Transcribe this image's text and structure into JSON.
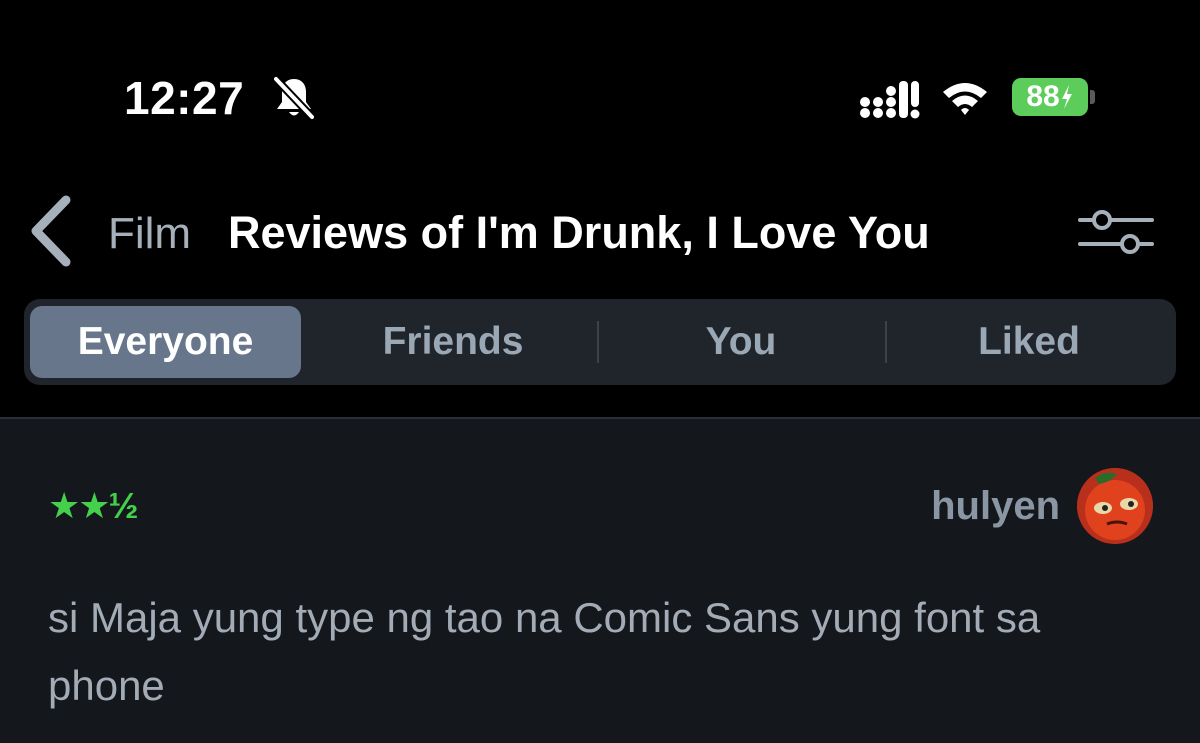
{
  "status_bar": {
    "time": "12:27",
    "battery": "88",
    "battery_color": "#5ccc5a"
  },
  "nav": {
    "back_icon": "chevron-left-icon",
    "label": "Film",
    "title": "Reviews of I'm Drunk, I Love You",
    "filter_icon": "sliders-icon"
  },
  "tabs": [
    {
      "label": "Everyone",
      "active": true
    },
    {
      "label": "Friends",
      "active": false
    },
    {
      "label": "You",
      "active": false
    },
    {
      "label": "Liked",
      "active": false
    }
  ],
  "review": {
    "rating": "★★½",
    "rating_value": 2.5,
    "rating_color": "#44d04c",
    "username": "hulyen",
    "text": "si Maja yung type ng tao na Comic Sans yung font sa phone"
  }
}
